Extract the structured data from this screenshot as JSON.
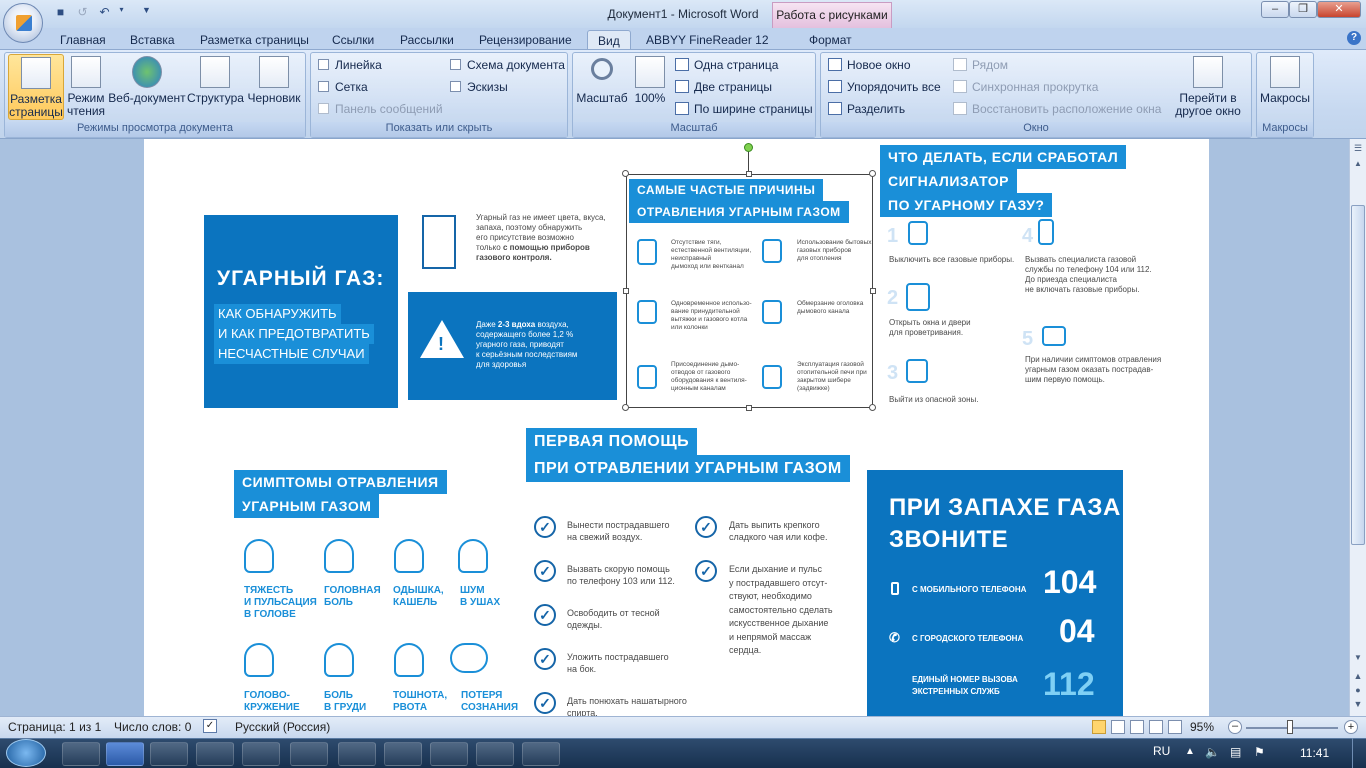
{
  "window": {
    "title": "Документ1 - Microsoft Word",
    "context_tab_group": "Работа с рисунками"
  },
  "tabs": [
    "Главная",
    "Вставка",
    "Разметка страницы",
    "Ссылки",
    "Рассылки",
    "Рецензирование",
    "Вид",
    "ABBYY FineReader 12",
    "Формат"
  ],
  "ribbon": {
    "doc_views": {
      "label": "Режимы просмотра документа",
      "buttons": [
        "Разметка\nстраницы",
        "Режим\nчтения",
        "Веб-документ",
        "Структура",
        "Черновик"
      ]
    },
    "show_hide": {
      "label": "Показать или скрыть",
      "items": [
        "Линейка",
        "Сетка",
        "Панель сообщений",
        "Схема документа",
        "Эскизы"
      ]
    },
    "zoom": {
      "label": "Масштаб",
      "zoom_btn": "Масштаб",
      "pct_btn": "100%",
      "one_page": "Одна страница",
      "two_pages": "Две страницы",
      "page_width": "По ширине страницы"
    },
    "window_grp": {
      "label": "Окно",
      "new_window": "Новое окно",
      "arrange_all": "Упорядочить все",
      "split": "Разделить",
      "side_by_side": "Рядом",
      "sync_scroll": "Синхронная прокрутка",
      "reset_pos": "Восстановить расположение окна",
      "switch": "Перейти в\nдругое окно"
    },
    "macros": {
      "label": "Макросы",
      "btn": "Макросы"
    }
  },
  "poster": {
    "co_title": "УГАРНЫЙ ГАЗ:",
    "co_sub": [
      "КАК  ОБНАРУЖИТЬ",
      "И КАК ПРЕДОТВРАТИТЬ",
      "НЕСЧАСТНЫЕ СЛУЧАИ"
    ],
    "detector_text": [
      "Угарный газ не имеет цвета, вкуса,",
      "запаха, поэтому обнаружить",
      "его присутствие возможно",
      "только "
    ],
    "detector_bold": [
      "с помощью приборов",
      "газового контроля."
    ],
    "warn_pre": "Даже ",
    "warn_bold": "2-3 вдоха",
    "warn_text": [
      " воздуха,",
      "содержащего более 1,2 %",
      "угарного газа, приводят",
      "к серьёзным последствиям",
      "для здоровья"
    ],
    "causes_title": [
      "САМЫЕ ЧАСТЫЕ ПРИЧИНЫ",
      "ОТРАВЛЕНИЯ УГАРНЫМ ГАЗОМ"
    ],
    "causes": [
      [
        "Отсутствие тяги,",
        "естественной вентиляции,",
        "неисправный",
        "дымоход или вентканал"
      ],
      [
        "Использование бытовых",
        "газовых приборов",
        "для отопления"
      ],
      [
        "Одновременное использо-",
        "вание принудительной",
        "вытяжки и газового котла",
        "или колонки"
      ],
      [
        "Обмерзание оголовка",
        "дымового канала"
      ],
      [
        "Присоединение дымо-",
        "отводов от газового",
        "оборудования к вентиля-",
        "ционным каналам"
      ],
      [
        "Эксплуатация газовой",
        "отопительной печи при",
        "закрытом шибере",
        "(задвижке)"
      ]
    ],
    "action_title": [
      "ЧТО ДЕЛАТЬ, ЕСЛИ СРАБОТАЛ",
      "СИГНАЛИЗАТОР",
      "ПО УГАРНОМУ ГАЗУ?"
    ],
    "actions": [
      {
        "n": "1",
        "t": [
          "Выключить все газовые приборы."
        ]
      },
      {
        "n": "2",
        "t": [
          "Открыть окна и двери",
          "для проветривания."
        ]
      },
      {
        "n": "3",
        "t": [
          "Выйти из опасной зоны."
        ]
      },
      {
        "n": "4",
        "t": [
          "Вызвать специалиста газовой",
          "службы по телефону 104 или 112.",
          "До приезда специалиста",
          "не включать газовые приборы."
        ]
      },
      {
        "n": "5",
        "t": [
          "При наличии симптомов отравления",
          "угарным газом оказать пострадав-",
          "шим первую помощь."
        ]
      }
    ],
    "symptoms_title": [
      "СИМПТОМЫ ОТРАВЛЕНИЯ",
      "УГАРНЫМ ГАЗОМ"
    ],
    "symptoms": [
      [
        "ТЯЖЕСТЬ",
        "И ПУЛЬСАЦИЯ",
        "В ГОЛОВЕ"
      ],
      [
        "ГОЛОВНАЯ",
        "БОЛЬ"
      ],
      [
        "ОДЫШКА,",
        "КАШЕЛЬ"
      ],
      [
        "ШУМ",
        "В УШАХ"
      ],
      [
        "ГОЛОВО-",
        "КРУЖЕНИЕ"
      ],
      [
        "БОЛЬ",
        "В ГРУДИ"
      ],
      [
        "ТОШНОТА,",
        "РВОТА"
      ],
      [
        "ПОТЕРЯ",
        "СОЗНАНИЯ"
      ]
    ],
    "aid_title": [
      "ПЕРВАЯ ПОМОЩЬ",
      "ПРИ ОТРАВЛЕНИИ УГАРНЫМ ГАЗОМ"
    ],
    "aid_left": [
      [
        "Вынести пострадавшего",
        "на свежий воздух."
      ],
      [
        "Вызвать скорую помощь",
        "по телефону 103 или 112."
      ],
      [
        "Освободить от тесной",
        "одежды."
      ],
      [
        "Уложить пострадавшего",
        "на бок."
      ],
      [
        "Дать понюхать нашатырного",
        "спирта."
      ]
    ],
    "aid_right": [
      [
        "Дать выпить крепкого",
        "сладкого чая или кофе."
      ],
      [
        "Если дыхание и пульс",
        "у пострадавшего отсут-",
        "ствуют, необходимо",
        "самостоятельно сделать",
        "искусственное дыхание",
        "и непрямой массаж",
        "сердца."
      ]
    ],
    "call_title": [
      "ПРИ ЗАПАХЕ ГАЗА",
      "ЗВОНИТЕ"
    ],
    "calls": [
      {
        "label": "С МОБИЛЬНОГО ТЕЛЕФОНА",
        "num": "104"
      },
      {
        "label": "С ГОРОДСКОГО ТЕЛЕФОНА",
        "num": "04"
      },
      {
        "label": "ЕДИНЫЙ НОМЕР ВЫЗОВА\nЭКСТРЕННЫХ СЛУЖБ",
        "num": "112"
      }
    ]
  },
  "status": {
    "page": "Страница: 1 из 1",
    "words": "Число слов: 0",
    "lang": "Русский (Россия)",
    "zoom": "95%"
  },
  "taskbar": {
    "lang": "RU",
    "time": "11:41"
  },
  "colors": {
    "poster_blue": "#0b74bf",
    "accent_blue": "#1a8fd8"
  }
}
